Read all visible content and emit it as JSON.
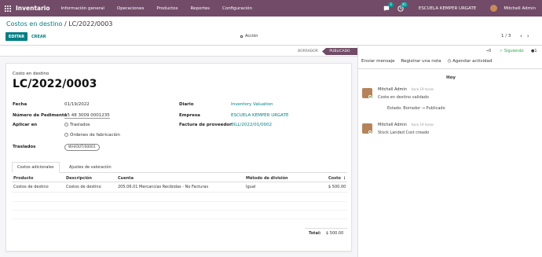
{
  "navbar": {
    "app_name": "Inventario",
    "menus": [
      "Información general",
      "Operaciones",
      "Productos",
      "Reportes",
      "Configuración"
    ],
    "chat_badge": "3",
    "activity_badge": "41",
    "company": "ESCUELA KEMPER URGATE",
    "user": "Mitchell Admin"
  },
  "control": {
    "breadcrumb_parent": "Costos en destino",
    "breadcrumb_sep": "/",
    "breadcrumb_current": "LC/2022/0003",
    "edit_label": "EDITAR",
    "create_label": "CREAR",
    "action_label": "Acción",
    "pager": "1 / 3"
  },
  "status": {
    "draft": "BORRADOR",
    "posted": "PUBLICADO"
  },
  "form": {
    "subtitle": "Costo en destino",
    "title": "LC/2022/0003",
    "fecha_label": "Fecha",
    "fecha_value": "01/19/2022",
    "pedimento_label": "Número de Pedimento",
    "pedimento_value": "15 48 3009 0001235",
    "aplicar_label": "Aplicar en",
    "aplicar_opt1": "Traslados",
    "aplicar_opt2": "Órdenes de fabricación",
    "traslados_label": "Traslados",
    "traslados_tag": "WH/OUT/00001",
    "diario_label": "Diario",
    "diario_value": "Inventory Valuation",
    "empresa_label": "Empresa",
    "empresa_value": "ESCUELA KEMPER URGATE",
    "factura_label": "Factura de proveedor",
    "factura_value": "BILL/2022/01/0002"
  },
  "tabs": {
    "active": "Costos adicionales",
    "other": "Ajustes de valoración"
  },
  "table": {
    "headers": [
      "Producto",
      "Descripción",
      "Cuenta",
      "Método de división",
      "Costo"
    ],
    "rows": [
      [
        "Costos de destino",
        "Costos de destino",
        "205.06.01 Mercancías Recibidas - No Facturas",
        "Igual",
        "$ 500.00"
      ]
    ],
    "total_label": "Total:",
    "total_value": "$ 500.00"
  },
  "chatter": {
    "attachments": "0",
    "following": "Siguiendo",
    "followers": "1",
    "send_message": "Enviar mensaje",
    "log_note": "Registrar una nota",
    "schedule_activity": "Agendar actividad",
    "day": "Hoy",
    "messages": [
      {
        "author": "Mitchell Admin",
        "date": "hace 19 horas",
        "body": "Coste en destino validado",
        "change": "Estado: Borrador → Publicado"
      },
      {
        "author": "Mitchell Admin",
        "date": "hace 19 horas",
        "body": "Stock Landed Cost creado"
      }
    ]
  },
  "colors": {
    "brand": "#714b67",
    "accent": "#017e84"
  }
}
